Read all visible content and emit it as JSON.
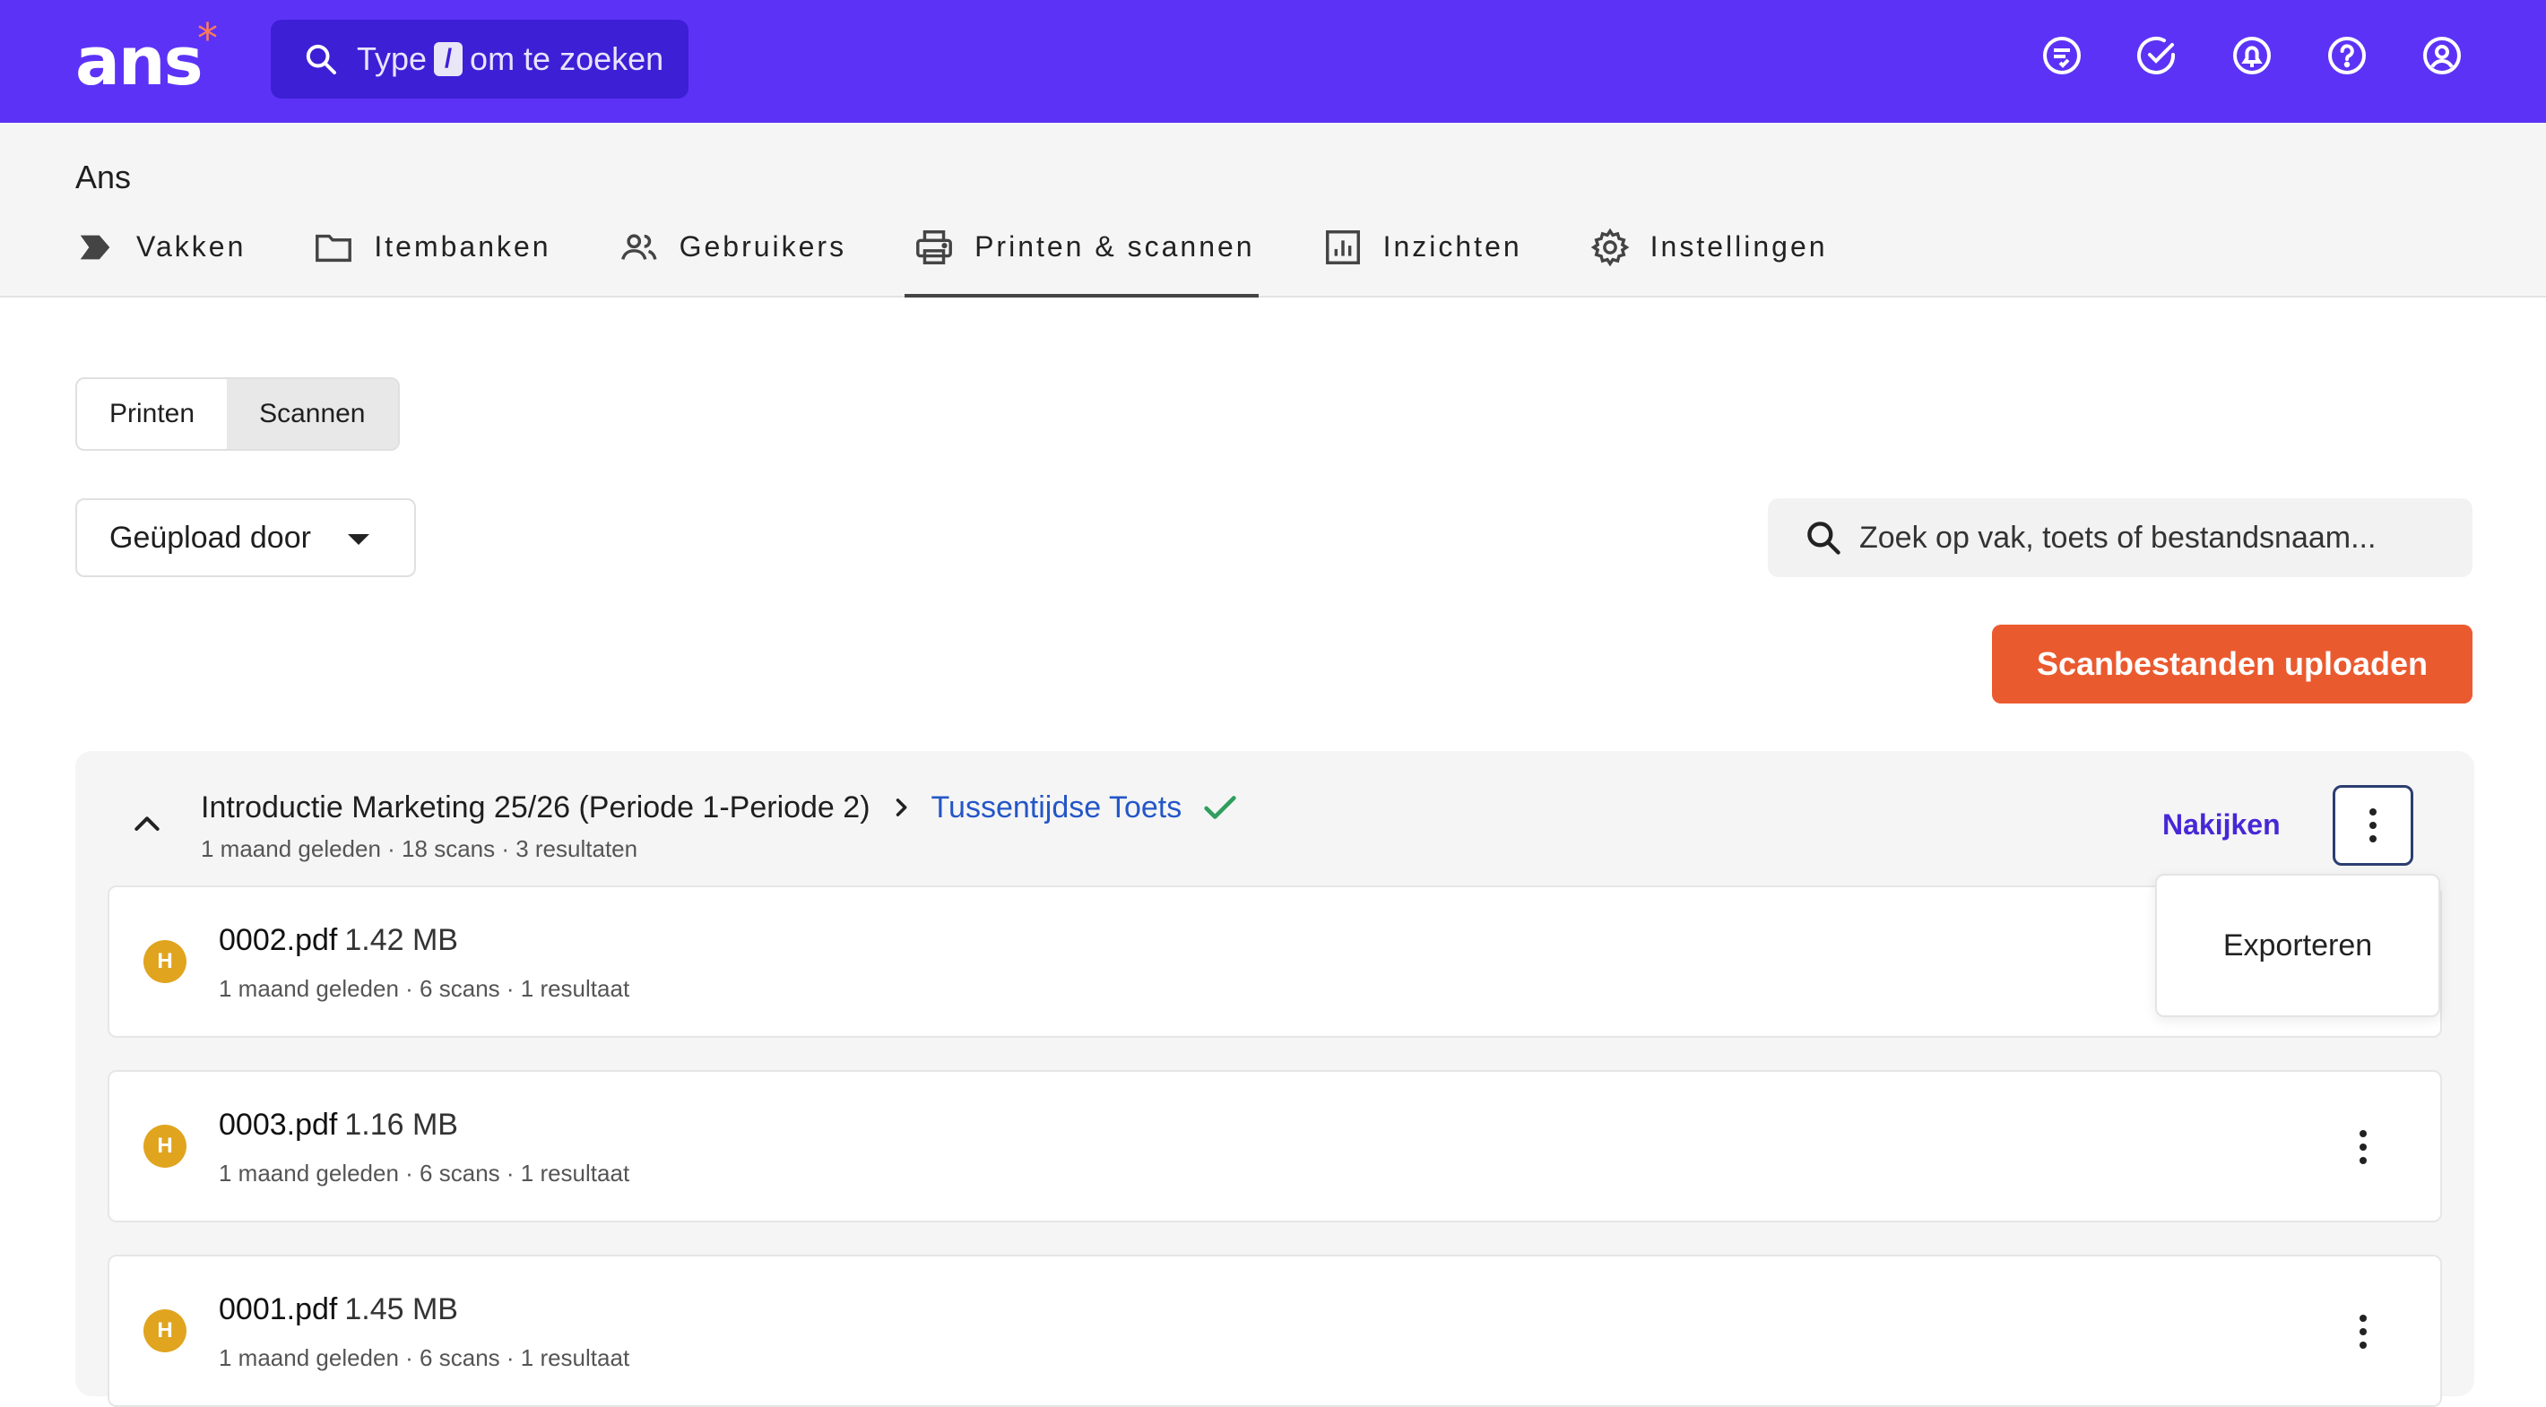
{
  "app": {
    "logo_text": "ans",
    "logo_mark": "*"
  },
  "global_search": {
    "prefix": "Type",
    "key": "/",
    "suffix": "om te zoeken"
  },
  "top_icons": [
    "messages-icon",
    "check-circle-icon",
    "notification-bell-icon",
    "help-icon",
    "account-icon"
  ],
  "organization": "Ans",
  "nav": {
    "tabs": [
      {
        "label": "Vakken",
        "icon": "vakken-icon"
      },
      {
        "label": "Itembanken",
        "icon": "folder-icon"
      },
      {
        "label": "Gebruikers",
        "icon": "users-icon"
      },
      {
        "label": "Printen & scannen",
        "icon": "printer-icon",
        "active": true
      },
      {
        "label": "Inzichten",
        "icon": "bar-chart-icon"
      },
      {
        "label": "Instellingen",
        "icon": "gear-icon"
      }
    ]
  },
  "mode_toggle": {
    "print_label": "Printen",
    "scan_label": "Scannen",
    "selected": "Scannen"
  },
  "filter": {
    "uploaded_by_label": "Geüpload door"
  },
  "search": {
    "placeholder": "Zoek op vak, toets of bestandsnaam..."
  },
  "upload_button": "Scanbestanden uploaden",
  "group": {
    "course": "Introductie Marketing 25/26 (Periode 1-Periode 2)",
    "test": "Tussentijdse Toets",
    "meta": "1 maand geleden · 18 scans · 3 resultaten",
    "grade_link": "Nakijken",
    "menu": {
      "items": [
        "Exporteren"
      ]
    },
    "files": [
      {
        "name": "0002.pdf",
        "size": "1.42 MB",
        "meta": "1 maand geleden · 6 scans · 1 resultaat",
        "avatar": "H"
      },
      {
        "name": "0003.pdf",
        "size": "1.16 MB",
        "meta": "1 maand geleden · 6 scans · 1 resultaat",
        "avatar": "H"
      },
      {
        "name": "0001.pdf",
        "size": "1.45 MB",
        "meta": "1 maand geleden · 6 scans · 1 resultaat",
        "avatar": "H"
      }
    ]
  },
  "colors": {
    "brand": "#5c33f6",
    "upload": "#ea5a2f",
    "link": "#2456c8",
    "success": "#2f9e5f",
    "avatar": "#e0a41f"
  }
}
